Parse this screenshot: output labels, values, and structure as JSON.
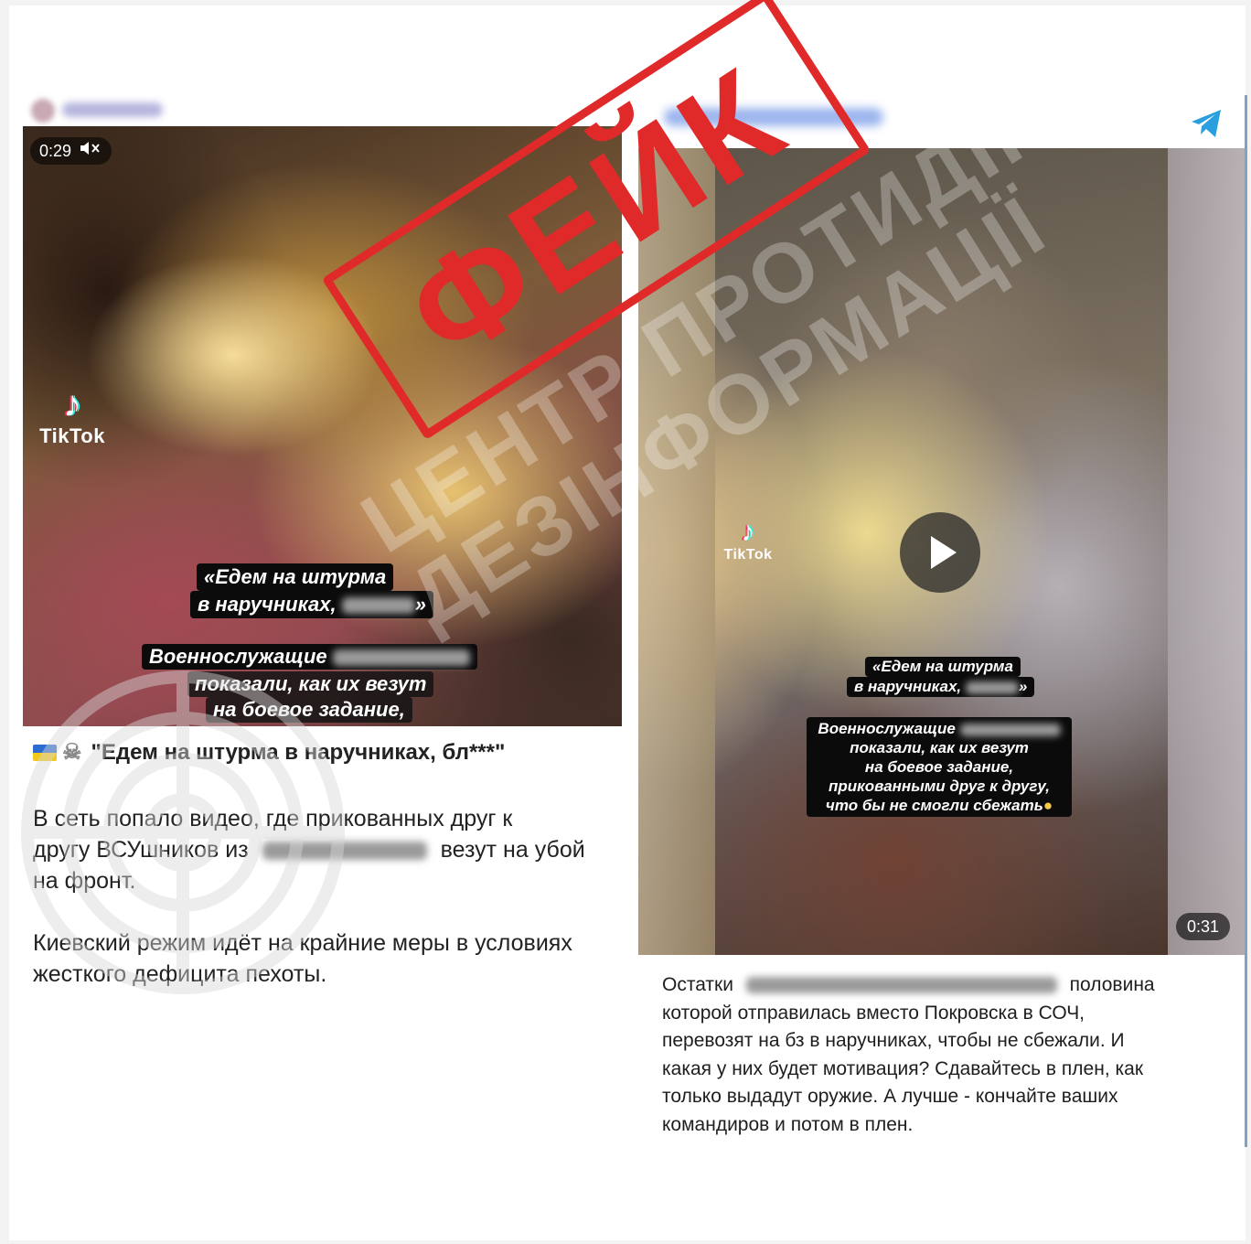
{
  "stamp": {
    "label": "ФЕЙК",
    "color": "#e02a2a"
  },
  "watermark": {
    "line1": "ЦЕНТР ПРОТИДІЇ",
    "line2": "ДЕЗІНФОРМАЦІЇ"
  },
  "left_post": {
    "video": {
      "time": "0:29",
      "mute_icon": "speaker-muted-icon",
      "tiktok_label": "TikTok",
      "caption_line1": "«Едем на штурма",
      "caption_line2": "в наручниках,",
      "caption_close": "»",
      "caption_line3": "Военнослужащие",
      "caption_line4": "показали, как их везут",
      "caption_line5": "на боевое задание,"
    },
    "title": "\"Едем на штурма в наручниках, бл***\"",
    "title_icons": [
      "flag-icon",
      "skull-crossbones-icon"
    ],
    "para1_a": "В сеть попало видео, где прикованных друг к",
    "para1_b": "другу ВСУшников из",
    "para1_c": "везут на убой",
    "para1_d": "на фронт.",
    "para2_a": "Киевский режим идёт на крайние меры в условиях",
    "para2_b": "жесткого дефицита пехоты."
  },
  "right_post": {
    "send_icon": "telegram-icon",
    "video": {
      "duration": "0:31",
      "tiktok_label": "TikTok",
      "play_icon": "play-icon",
      "caption_line1": "«Едем на штурма",
      "caption_line2": "в наручниках,",
      "caption_close": "»",
      "caption_line3": "Военнослужащие",
      "caption_line4": "показали, как их везут",
      "caption_line5": "на боевое задание,",
      "caption_line6": "прикованными друг к другу,",
      "caption_line7": "что бы не смогли сбежать"
    },
    "text_line1_a": "Остатки",
    "text_line1_b": "половина",
    "text_line2": "которой отправилась вместо Покровска в СОЧ,",
    "text_line3": "перевозят на бз в наручниках, чтобы не сбежали. И",
    "text_line4": "какая у них будет мотивация? Сдавайтесь в плен, как",
    "text_line5": "только выдадут оружие. А лучше - кончайте ваших",
    "text_line6": "командиров и потом в плен."
  }
}
